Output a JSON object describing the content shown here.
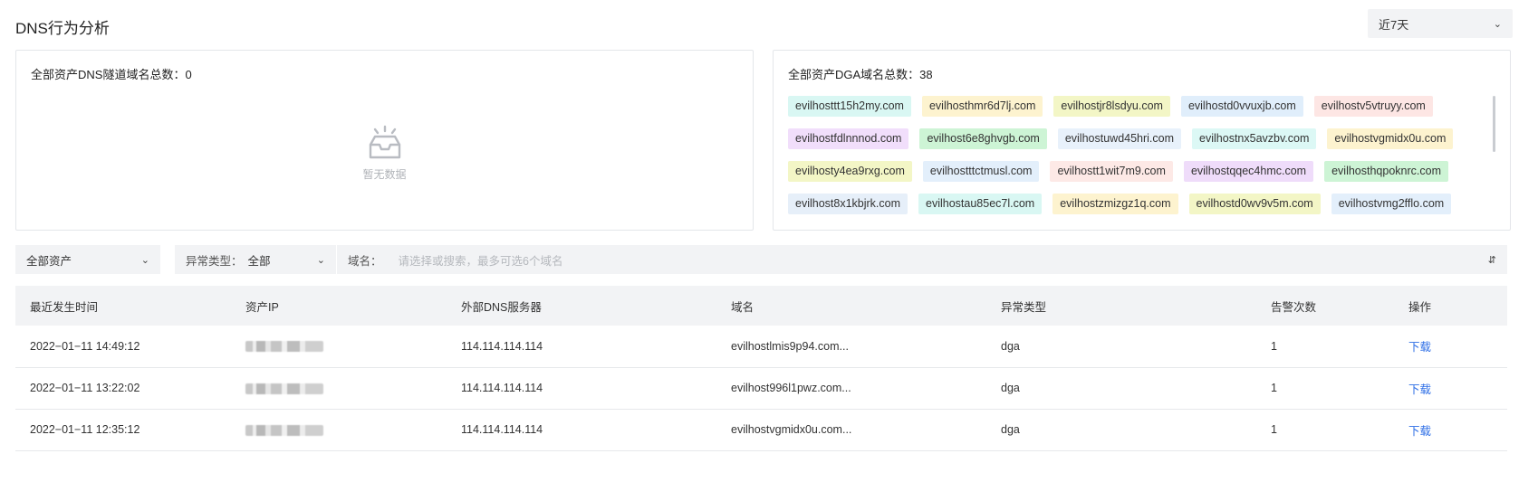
{
  "header": {
    "title": "DNS行为分析",
    "range": "近7天"
  },
  "tunnel_panel": {
    "title": "全部资产DNS隧道域名总数：0",
    "empty_text": "暂无数据"
  },
  "dga_panel": {
    "title": "全部资产DGA域名总数：38",
    "tags": [
      {
        "label": "evilhosttt15h2my.com",
        "color": "#d9f7f3"
      },
      {
        "label": "evilhosthmr6d7lj.com",
        "color": "#fdf3cf"
      },
      {
        "label": "evilhostjr8lsdyu.com",
        "color": "#f3f6c6"
      },
      {
        "label": "evilhostd0vvuxjb.com",
        "color": "#e0eefb"
      },
      {
        "label": "evilhostv5vtruyy.com",
        "color": "#fde6e4"
      },
      {
        "label": "evilhostfdlnnnod.com",
        "color": "#f1defb"
      },
      {
        "label": "evilhost6e8ghvgb.com",
        "color": "#cdf4d5"
      },
      {
        "label": "evilhostuwd45hri.com",
        "color": "#e8f1fb"
      },
      {
        "label": "evilhostnx5avzbv.com",
        "color": "#dcf8f5"
      },
      {
        "label": "evilhostvgmidx0u.com",
        "color": "#fdf3cf"
      },
      {
        "label": "evilhosty4ea9rxg.com",
        "color": "#f3f6c6"
      },
      {
        "label": "evilhostttctmusl.com",
        "color": "#e3effb"
      },
      {
        "label": "evilhostt1wit7m9.com",
        "color": "#fde9e6"
      },
      {
        "label": "evilhostqqec4hmc.com",
        "color": "#efdcfa"
      },
      {
        "label": "evilhosthqpoknrc.com",
        "color": "#cdf4d5"
      },
      {
        "label": "evilhost8x1kbjrk.com",
        "color": "#e6eff9"
      },
      {
        "label": "evilhostau85ec7l.com",
        "color": "#d9f7f3"
      },
      {
        "label": "evilhostzmizgz1q.com",
        "color": "#fdf3cf"
      },
      {
        "label": "evilhostd0wv9v5m.com",
        "color": "#f3f6c6"
      },
      {
        "label": "evilhostvmg2fflo.com",
        "color": "#e3effb"
      }
    ]
  },
  "filters": {
    "asset": "全部资产",
    "type_label": "异常类型：",
    "type_value": "全部",
    "domain_label": "域名：",
    "domain_placeholder": "请选择或搜索，最多可选6个域名"
  },
  "table": {
    "columns": [
      "最近发生时间",
      "资产IP",
      "外部DNS服务器",
      "域名",
      "异常类型",
      "告警次数",
      "操作"
    ],
    "rows": [
      {
        "time": "2022−01−11 14:49:12",
        "dns": "114.114.114.114",
        "domain": "evilhostlmis9p94.com...",
        "type": "dga",
        "count": "1",
        "action": "下载"
      },
      {
        "time": "2022−01−11 13:22:02",
        "dns": "114.114.114.114",
        "domain": "evilhost996l1pwz.com...",
        "type": "dga",
        "count": "1",
        "action": "下载"
      },
      {
        "time": "2022−01−11 12:35:12",
        "dns": "114.114.114.114",
        "domain": "evilhostvgmidx0u.com...",
        "type": "dga",
        "count": "1",
        "action": "下载"
      }
    ]
  }
}
